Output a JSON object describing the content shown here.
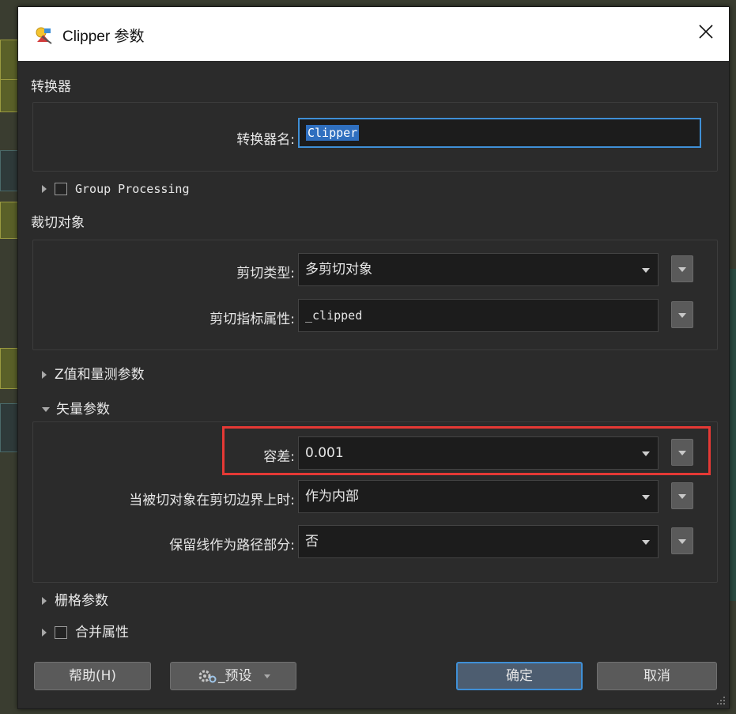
{
  "dialog": {
    "title": "Clipper 参数",
    "close_glyph": "✕"
  },
  "transformer_section": {
    "label": "转换器",
    "name_label": "转换器名:",
    "name_value": "Clipper"
  },
  "group_processing": {
    "label": "Group Processing",
    "checked": false
  },
  "clip_section": {
    "label": "裁切对象",
    "clip_type_label": "剪切类型:",
    "clip_type_value": "多剪切对象",
    "clip_indicator_label": "剪切指标属性:",
    "clip_indicator_value": "_clipped"
  },
  "z_section": {
    "label": "Z值和量测参数"
  },
  "vector_section": {
    "label": "矢量参数",
    "tolerance_label": "容差:",
    "tolerance_value": "0.001",
    "on_boundary_label": "当被切对象在剪切边界上时:",
    "on_boundary_value": "作为内部",
    "preserve_lines_label": "保留线作为路径部分:",
    "preserve_lines_value": "否"
  },
  "raster_section": {
    "label": "栅格参数"
  },
  "merge_attributes": {
    "label": "合并属性",
    "checked": false
  },
  "footer": {
    "help_label": "帮助(H)",
    "preset_label": "_预设",
    "ok_label": "确定",
    "cancel_label": "取消"
  },
  "colors": {
    "dialog_bg": "#2b2b2b",
    "focus_blue": "#3f8fd6",
    "highlight_red": "#e53935",
    "button_gray": "#5a5a5a"
  },
  "icons": [
    "fme-transformer-icon",
    "close-icon",
    "chevron-down-icon",
    "expand-arrow-icon",
    "gear-icon",
    "resize-grip-icon"
  ]
}
